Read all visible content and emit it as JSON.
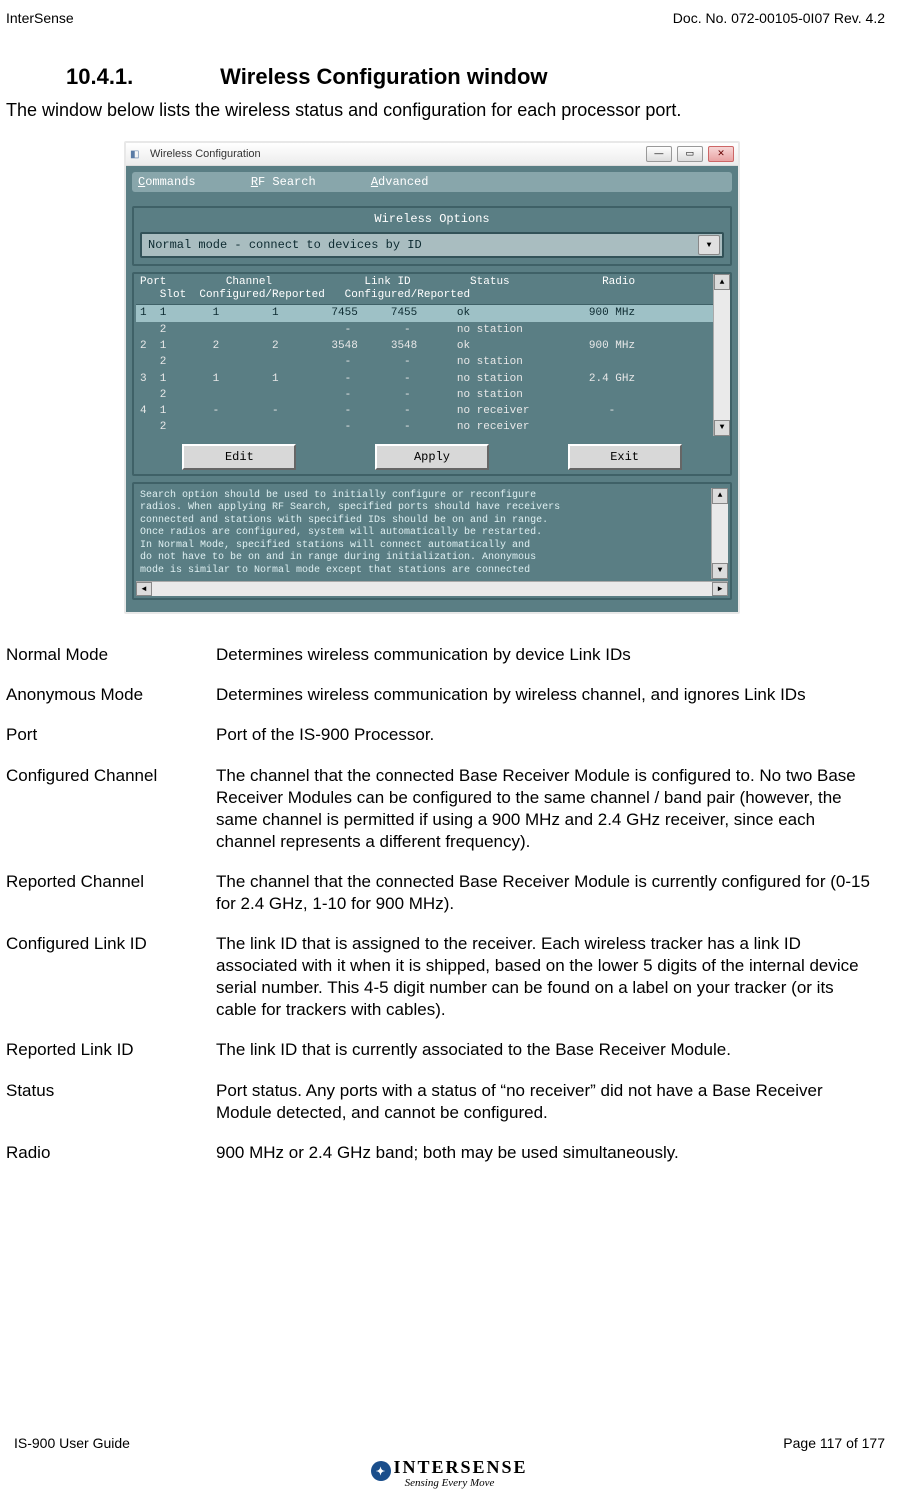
{
  "header": {
    "left": "InterSense",
    "right": "Doc. No. 072-00105-0I07 Rev. 4.2"
  },
  "section": {
    "number": "10.4.1.",
    "title": "Wireless Configuration window"
  },
  "intro": "The window below lists the wireless status and configuration for each processor port.",
  "window": {
    "title": "Wireless Configuration",
    "menu": {
      "m1": "Commands",
      "m2": "RF Search",
      "m3": "Advanced"
    },
    "panel_title": "Wireless Options",
    "mode_selected": "Normal mode - connect to devices by ID",
    "table_header_line1": "Port         Channel              Link ID         Status              Radio",
    "table_header_line2": "   Slot  Configured/Reported   Configured/Reported",
    "rows": [
      "1  1       1        1        7455     7455      ok                  900 MHz",
      "   2                           -        -       no station",
      "2  1       2        2        3548     3548      ok                  900 MHz",
      "   2                           -        -       no station",
      "3  1       1        1          -        -       no station          2.4 GHz",
      "   2                           -        -       no station",
      "4  1       -        -          -        -       no receiver            -",
      "   2                           -        -       no receiver"
    ],
    "buttons": {
      "edit": "Edit",
      "apply": "Apply",
      "exit": "Exit"
    },
    "info_lines": [
      "Search option should be used to initially configure or reconfigure",
      "radios. When applying RF Search, specified ports should have receivers",
      "connected and stations with specified IDs should be on and in range.",
      "Once radios are configured, system will automatically be restarted.",
      "In Normal Mode, specified stations will connect automatically and",
      "do not have to be on and in range during initialization. Anonymous",
      "mode is similar to Normal mode except that stations are connected"
    ]
  },
  "definitions": [
    {
      "term": "Normal Mode",
      "desc": "Determines wireless communication by device Link IDs"
    },
    {
      "term": "Anonymous Mode",
      "desc": "Determines wireless communication by wireless channel, and ignores Link IDs"
    },
    {
      "term": "Port",
      "desc": "Port of the IS-900 Processor."
    },
    {
      "term": "Configured Channel",
      "desc": "The channel that the connected Base Receiver Module is configured to.  No two Base Receiver Modules can be configured to the same channel / band pair (however, the same channel is permitted if using a 900 MHz and 2.4 GHz receiver, since each channel represents a different frequency)."
    },
    {
      "term": "Reported Channel",
      "desc": "The channel that the connected Base Receiver Module is currently configured for (0-15 for 2.4 GHz, 1-10 for 900 MHz)."
    },
    {
      "term": "Configured Link ID",
      "desc": "The link ID that is assigned to the receiver.  Each wireless tracker has a link ID associated with it when it is shipped, based on the lower 5 digits of the internal device serial number.  This 4-5 digit number can be found on a label on your tracker (or its cable for trackers with cables)."
    },
    {
      "term": "Reported Link ID",
      "desc": "The link ID that is currently associated to the Base Receiver Module."
    },
    {
      "term": "Status",
      "desc": "Port status.  Any ports with a status of “no receiver” did not have a Base Receiver Module detected, and cannot be configured."
    },
    {
      "term": "Radio",
      "desc": "900 MHz or 2.4 GHz band; both may be used simultaneously."
    }
  ],
  "footer": {
    "left": "IS-900 User Guide",
    "right": "Page 117 of 177"
  },
  "logo": {
    "name": "INTERSENSE",
    "tagline": "Sensing Every Move"
  }
}
